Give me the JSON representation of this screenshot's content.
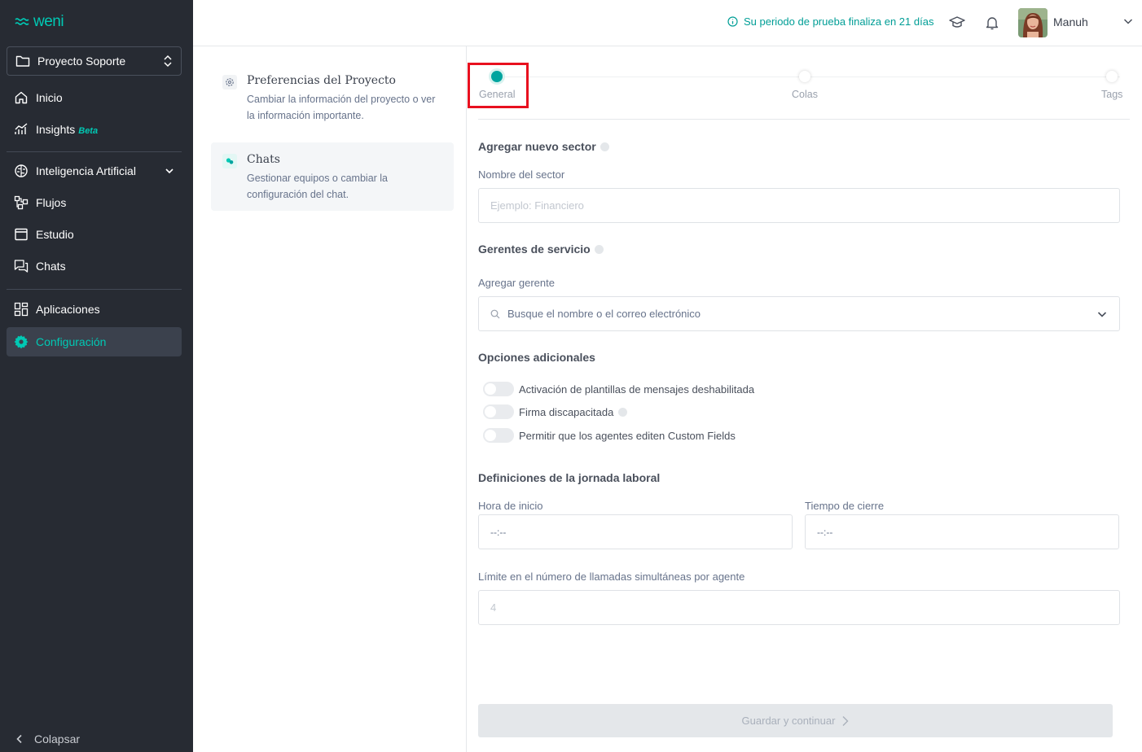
{
  "brand": {
    "logo_text": "weni",
    "accent": "#00c9b4"
  },
  "sidebar": {
    "project": "Proyecto Soporte",
    "items": [
      {
        "label": "Inicio",
        "icon": "home-icon"
      },
      {
        "label": "Insights",
        "badge": "Beta",
        "icon": "chart-icon"
      },
      {
        "label": "Inteligencia Artificial",
        "icon": "brain-icon",
        "expandable": true
      },
      {
        "label": "Flujos",
        "icon": "flows-icon"
      },
      {
        "label": "Estudio",
        "icon": "window-icon"
      },
      {
        "label": "Chats",
        "icon": "chats-icon"
      },
      {
        "label": "Aplicaciones",
        "icon": "apps-icon"
      },
      {
        "label": "Configuración",
        "icon": "gear-icon",
        "active": true
      }
    ],
    "collapse_label": "Colapsar"
  },
  "topbar": {
    "trial_text": "Su periodo de prueba finaliza en 21 días",
    "user_name": "Manuh"
  },
  "settings_menu": [
    {
      "title": "Preferencias del Proyecto",
      "description": "Cambiar la información del proyecto o ver la información importante."
    },
    {
      "title": "Chats",
      "description": "Gestionar equipos o cambiar la configuración del chat.",
      "active": true
    }
  ],
  "stepper": {
    "steps": [
      {
        "label": "General",
        "active": true
      },
      {
        "label": "Colas"
      },
      {
        "label": "Tags"
      }
    ]
  },
  "form": {
    "sector_title": "Agregar nuevo sector",
    "sector_name_label": "Nombre del sector",
    "sector_name_placeholder": "Ejemplo: Financiero",
    "managers_title": "Gerentes de servicio",
    "add_manager_label": "Agregar gerente",
    "add_manager_placeholder": "Busque el nombre o el correo electrónico",
    "options_title": "Opciones adicionales",
    "toggles": [
      {
        "label": "Activación de plantillas de mensajes deshabilitada",
        "on": false
      },
      {
        "label": "Firma discapacitada",
        "on": false,
        "info": true
      },
      {
        "label": "Permitir que los agentes editen Custom Fields",
        "on": false
      }
    ],
    "workday_title": "Definiciones de la jornada laboral",
    "start_label": "Hora de inicio",
    "start_value": "--:--",
    "end_label": "Tiempo de cierre",
    "end_value": "--:--",
    "limit_label": "Límite en el número de llamadas simultáneas por agente",
    "limit_value": "4",
    "save_label": "Guardar y continuar"
  }
}
